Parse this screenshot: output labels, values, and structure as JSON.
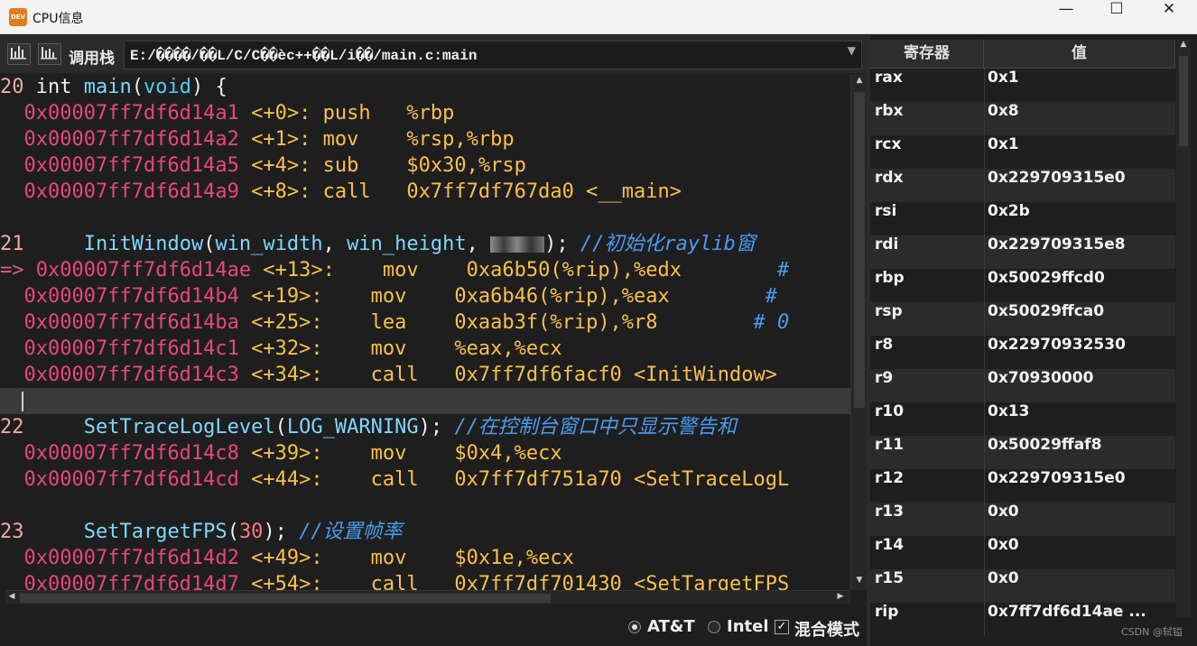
{
  "window": {
    "title": "CPU信息",
    "app_icon_text": "DEV",
    "minimize": "—",
    "maximize": "☐",
    "close": "✕"
  },
  "toolbar": {
    "btn1_icon": "bar-chart-icon",
    "btn2_icon": "bar-chart-icon",
    "callstack_label": "调用栈",
    "path": "E:/����/��L/C/C��èc++��L/i��/main.c:main"
  },
  "code": {
    "lines": [
      {
        "type": "src",
        "lineno": "20",
        "parts": [
          [
            "pl",
            " int "
          ],
          [
            "fn",
            "main"
          ],
          [
            "pl",
            "("
          ],
          [
            "kw",
            "void"
          ],
          [
            "pl",
            ") {"
          ]
        ]
      },
      {
        "type": "asm",
        "prefix": "  ",
        "addr": "0x00007ff7df6d14a1",
        "off": "<+0>:",
        "gap": " ",
        "mn": "push",
        "pad": "   ",
        "opr": "%rbp"
      },
      {
        "type": "asm",
        "prefix": "  ",
        "addr": "0x00007ff7df6d14a2",
        "off": "<+1>:",
        "gap": " ",
        "mn": "mov",
        "pad": "    ",
        "opr": "%rsp,%rbp"
      },
      {
        "type": "asm",
        "prefix": "  ",
        "addr": "0x00007ff7df6d14a5",
        "off": "<+4>:",
        "gap": " ",
        "mn": "sub",
        "pad": "    ",
        "opr": "$0x30,%rsp"
      },
      {
        "type": "asm",
        "prefix": "  ",
        "addr": "0x00007ff7df6d14a9",
        "off": "<+8>:",
        "gap": " ",
        "mn": "call",
        "pad": "   ",
        "opr": "0x7ff7df767da0 <__main>"
      },
      {
        "type": "blank"
      },
      {
        "type": "src",
        "lineno": "21",
        "parts": [
          [
            "pl",
            "     "
          ],
          [
            "fn",
            "InitWindow"
          ],
          [
            "pl",
            "("
          ],
          [
            "fn",
            "win_width"
          ],
          [
            "pl",
            ", "
          ],
          [
            "fn",
            "win_height"
          ],
          [
            "pl",
            ", "
          ],
          [
            "blur",
            ""
          ],
          [
            "pl",
            "); "
          ],
          [
            "cm",
            "//初始化raylib窗"
          ]
        ]
      },
      {
        "type": "asm",
        "prefix": "=> ",
        "addr": "0x00007ff7df6d14ae",
        "off": "<+13>:",
        "gap": "    ",
        "mn": "mov",
        "pad": "    ",
        "opr": "0xa6b50(%rip),%edx",
        "cm": "        #"
      },
      {
        "type": "asm",
        "prefix": "  ",
        "addr": "0x00007ff7df6d14b4",
        "off": "<+19>:",
        "gap": "    ",
        "mn": "mov",
        "pad": "    ",
        "opr": "0xa6b46(%rip),%eax",
        "cm": "        #"
      },
      {
        "type": "asm",
        "prefix": "  ",
        "addr": "0x00007ff7df6d14ba",
        "off": "<+25>:",
        "gap": "    ",
        "mn": "lea",
        "pad": "    ",
        "opr": "0xaab3f(%rip),%r8",
        "cm": "        # 0"
      },
      {
        "type": "asm",
        "prefix": "  ",
        "addr": "0x00007ff7df6d14c1",
        "off": "<+32>:",
        "gap": "    ",
        "mn": "mov",
        "pad": "    ",
        "opr": "%eax,%ecx"
      },
      {
        "type": "asm",
        "prefix": "  ",
        "addr": "0x00007ff7df6d14c3",
        "off": "<+34>:",
        "gap": "    ",
        "mn": "call",
        "pad": "   ",
        "opr": "0x7ff7df6facf0 <InitWindow>"
      },
      {
        "type": "current"
      },
      {
        "type": "src",
        "lineno": "22",
        "parts": [
          [
            "pl",
            "     "
          ],
          [
            "fn",
            "SetTraceLogLevel"
          ],
          [
            "pl",
            "("
          ],
          [
            "fn",
            "LOG_WARNING"
          ],
          [
            "pl",
            "); "
          ],
          [
            "cm",
            "//在控制台窗口中只显示警告和"
          ]
        ]
      },
      {
        "type": "asm",
        "prefix": "  ",
        "addr": "0x00007ff7df6d14c8",
        "off": "<+39>:",
        "gap": "    ",
        "mn": "mov",
        "pad": "    ",
        "opr": "$0x4,%ecx"
      },
      {
        "type": "asm",
        "prefix": "  ",
        "addr": "0x00007ff7df6d14cd",
        "off": "<+44>:",
        "gap": "    ",
        "mn": "call",
        "pad": "   ",
        "opr": "0x7ff7df751a70 <SetTraceLogL"
      },
      {
        "type": "blank"
      },
      {
        "type": "src",
        "lineno": "23",
        "parts": [
          [
            "pl",
            "     "
          ],
          [
            "fn",
            "SetTargetFPS"
          ],
          [
            "pl",
            "("
          ],
          [
            "num",
            "30"
          ],
          [
            "pl",
            "); "
          ],
          [
            "cm",
            "//设置帧率"
          ]
        ]
      },
      {
        "type": "asm",
        "prefix": "  ",
        "addr": "0x00007ff7df6d14d2",
        "off": "<+49>:",
        "gap": "    ",
        "mn": "mov",
        "pad": "    ",
        "opr": "$0x1e,%ecx"
      },
      {
        "type": "asm",
        "prefix": "  ",
        "addr": "0x00007ff7df6d14d7",
        "off": "<+54>:",
        "gap": "    ",
        "mn": "call",
        "pad": "   ",
        "opr": "0x7ff7df701430 <SetTargetFPS"
      }
    ]
  },
  "syntax": {
    "radio_att": "AT&T",
    "radio_intel": "Intel",
    "mixed_label": "混合模式",
    "selected": "AT&T",
    "mixed_checked": true
  },
  "registers": {
    "header_name": "寄存器",
    "header_value": "值",
    "rows": [
      {
        "name": "rax",
        "value": "0x1"
      },
      {
        "name": "rbx",
        "value": "0x8"
      },
      {
        "name": "rcx",
        "value": "0x1"
      },
      {
        "name": "rdx",
        "value": "0x229709315e0"
      },
      {
        "name": "rsi",
        "value": "0x2b"
      },
      {
        "name": "rdi",
        "value": "0x229709315e8"
      },
      {
        "name": "rbp",
        "value": "0x50029ffcd0"
      },
      {
        "name": "rsp",
        "value": "0x50029ffca0"
      },
      {
        "name": "r8",
        "value": "0x22970932530"
      },
      {
        "name": "r9",
        "value": "0x70930000"
      },
      {
        "name": "r10",
        "value": "0x13"
      },
      {
        "name": "r11",
        "value": "0x50029ffaf8"
      },
      {
        "name": "r12",
        "value": "0x229709315e0"
      },
      {
        "name": "r13",
        "value": "0x0"
      },
      {
        "name": "r14",
        "value": "0x0"
      },
      {
        "name": "r15",
        "value": "0x0"
      },
      {
        "name": "rip",
        "value": "0x7ff7df6d14ae ..."
      }
    ]
  },
  "watermark": "CSDN @轼镒"
}
